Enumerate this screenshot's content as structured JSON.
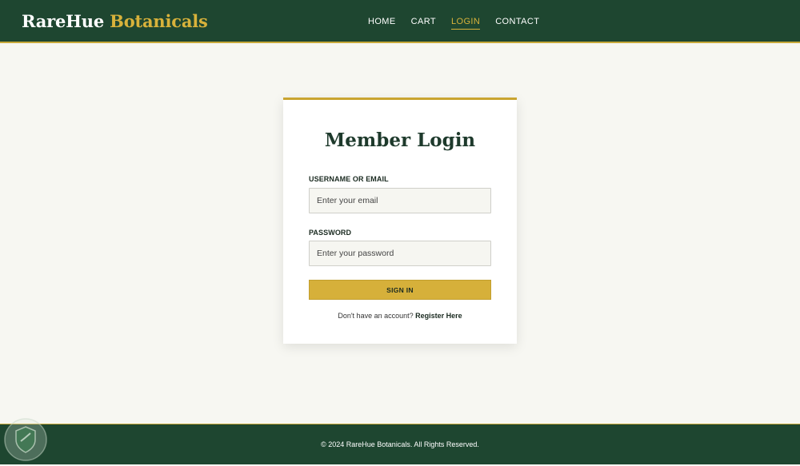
{
  "header": {
    "brand_part1": "RareHue",
    "brand_part2": "Botanicals",
    "nav": [
      {
        "label": "HOME",
        "active": false
      },
      {
        "label": "CART",
        "active": false
      },
      {
        "label": "LOGIN",
        "active": true
      },
      {
        "label": "CONTACT",
        "active": false
      }
    ]
  },
  "login": {
    "title": "Member Login",
    "username_label": "USERNAME OR EMAIL",
    "username_placeholder": "Enter your email",
    "password_label": "PASSWORD",
    "password_placeholder": "Enter your password",
    "signin_label": "SIGN IN",
    "register_prompt": "Don't have an account?",
    "register_link": "Register Here"
  },
  "footer": {
    "text": "© 2024 RareHue Botanicals. All Rights Reserved."
  },
  "colors": {
    "primary_green": "#1e4630",
    "accent_gold": "#d6b03a",
    "background": "#f7f7f2"
  },
  "icons": {
    "watermark": "shield-logo-icon"
  }
}
